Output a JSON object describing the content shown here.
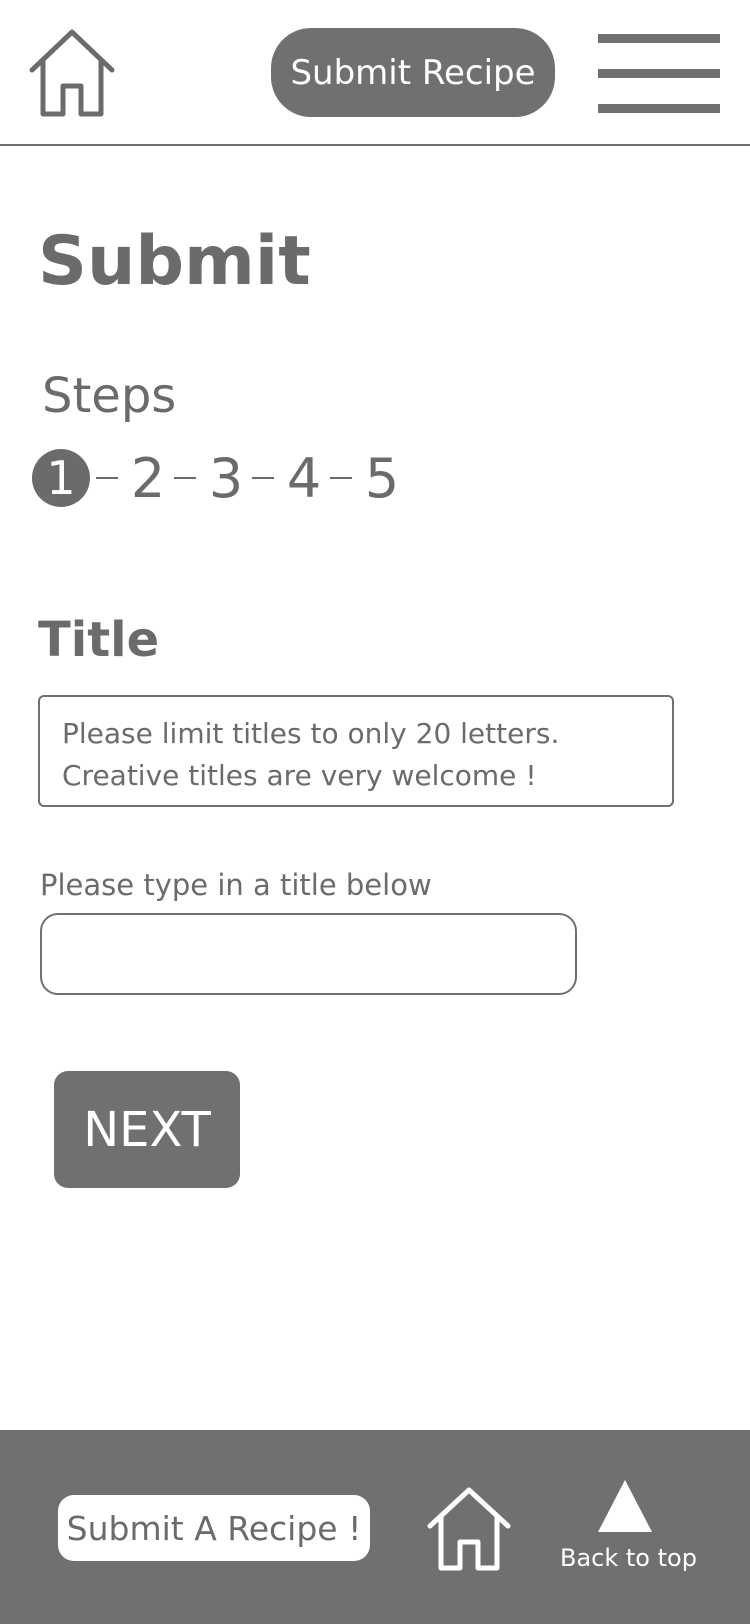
{
  "header": {
    "home_icon": "home-icon",
    "submit_button": "Submit Recipe",
    "menu_icon": "hamburger-menu-icon"
  },
  "main": {
    "page_title": "Submit",
    "steps_label": "Steps",
    "steps": [
      "1",
      "2",
      "3",
      "4",
      "5"
    ],
    "current_step": 1,
    "section_title": "Title",
    "hint_line1": "Please limit titles to only 20 letters.",
    "hint_line2": "Creative titles are very welcome !",
    "field_label": "Please type in a title below",
    "title_value": "",
    "next_button": "NEXT"
  },
  "footer": {
    "submit_button": "Submit A Recipe !",
    "home_icon": "home-icon",
    "back_to_top_icon": "triangle-up-icon",
    "back_to_top_label": "Back to top"
  },
  "colors": {
    "primary_gray": "#707070",
    "text_gray": "#6b6b6b",
    "background": "#ffffff"
  }
}
